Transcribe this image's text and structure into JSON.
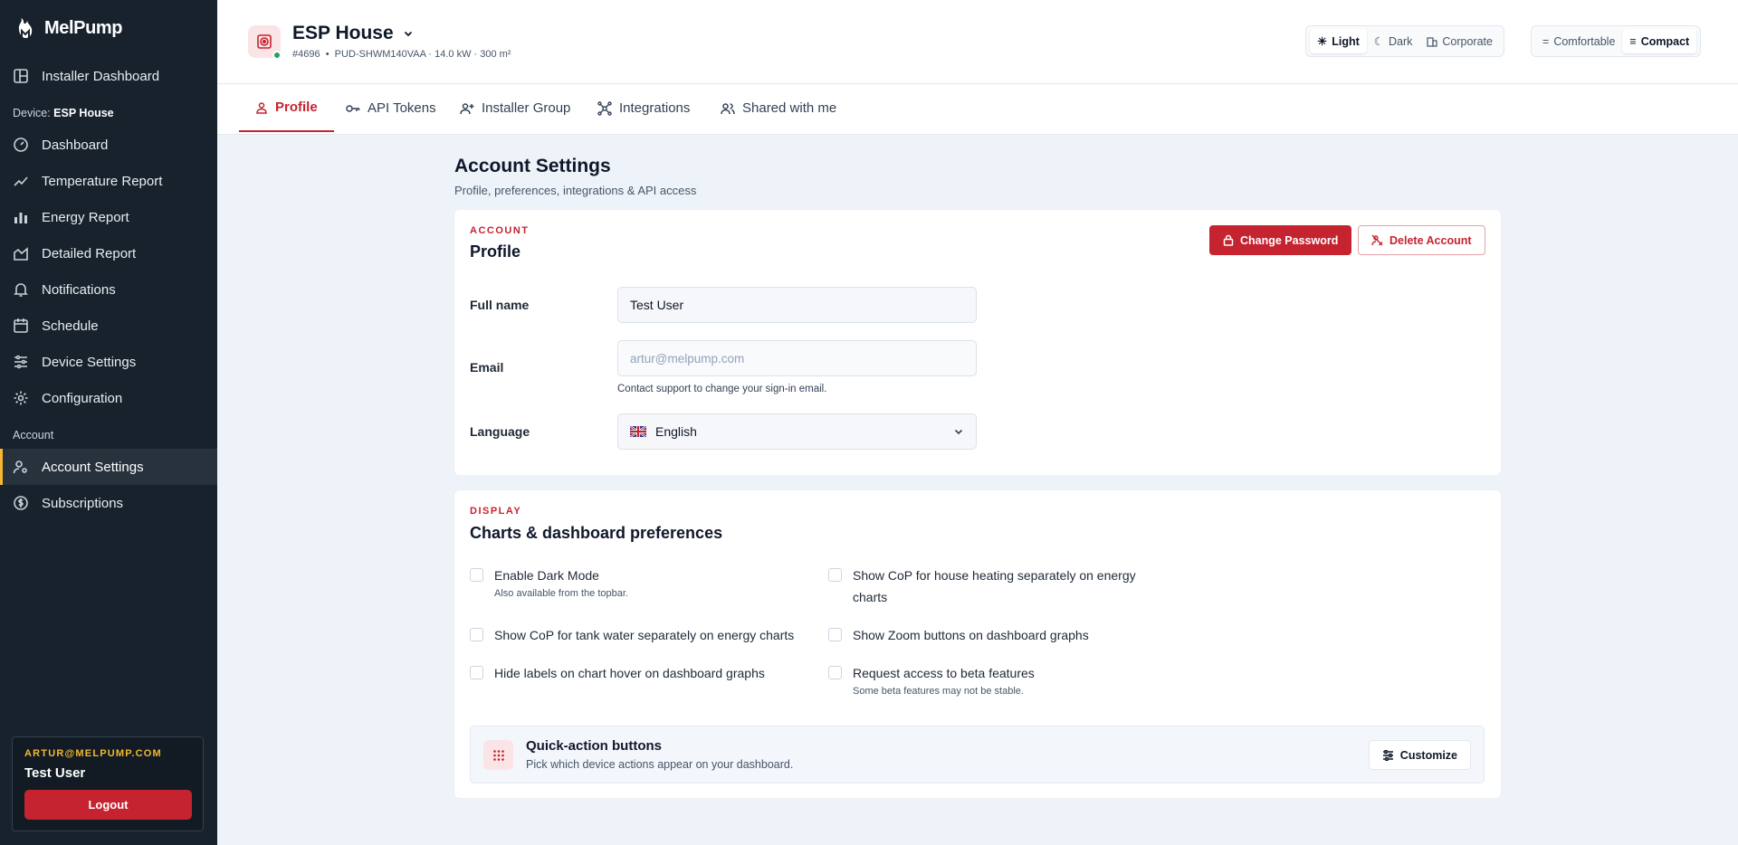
{
  "app": {
    "name": "MelPump"
  },
  "sidebar": {
    "installer_dashboard": "Installer Dashboard",
    "device_prefix": "Device:",
    "device_name": "ESP House",
    "items": [
      {
        "label": "Dashboard",
        "icon": "gauge-icon"
      },
      {
        "label": "Temperature Report",
        "icon": "line-chart-icon"
      },
      {
        "label": "Energy Report",
        "icon": "bar-chart-icon"
      },
      {
        "label": "Detailed Report",
        "icon": "area-chart-icon"
      },
      {
        "label": "Notifications",
        "icon": "bell-icon"
      },
      {
        "label": "Schedule",
        "icon": "calendar-icon"
      },
      {
        "label": "Device Settings",
        "icon": "sliders-icon"
      },
      {
        "label": "Configuration",
        "icon": "gear-icon"
      }
    ],
    "account_section": "Account",
    "account_items": [
      {
        "label": "Account Settings",
        "icon": "user-cog-icon",
        "active": true
      },
      {
        "label": "Subscriptions",
        "icon": "dollar-circle-icon"
      }
    ],
    "user": {
      "email": "ARTUR@MELPUMP.COM",
      "name": "Test User",
      "logout_label": "Logout"
    }
  },
  "topbar": {
    "device_name": "ESP House",
    "device_id": "#4696",
    "device_specs": "PUD-SHWM140VAA · 14.0 kW · 300 m²",
    "status_color": "#22a55a",
    "themes": [
      "Light",
      "Dark",
      "Corporate"
    ],
    "selected_theme": "Light",
    "density": [
      "Comfortable",
      "Compact"
    ],
    "selected_density": "Compact"
  },
  "tabs": [
    {
      "label": "Profile",
      "icon": "user-icon",
      "active": true
    },
    {
      "label": "API Tokens",
      "icon": "key-icon"
    },
    {
      "label": "Installer Group",
      "icon": "user-plus-icon"
    },
    {
      "label": "Integrations",
      "icon": "integration-icon"
    },
    {
      "label": "Shared with me",
      "icon": "users-icon"
    }
  ],
  "page": {
    "title": "Account Settings",
    "subtitle": "Profile, preferences, integrations & API access"
  },
  "profile_card": {
    "eyebrow": "ACCOUNT",
    "title": "Profile",
    "change_password": "Change Password",
    "delete_account": "Delete Account",
    "full_name_label": "Full name",
    "full_name_value": "Test User",
    "email_label": "Email",
    "email_placeholder": "artur@melpump.com",
    "email_help": "Contact support to change your sign-in email.",
    "language_label": "Language",
    "language_value": "English"
  },
  "display_card": {
    "eyebrow": "DISPLAY",
    "title": "Charts & dashboard preferences",
    "options": [
      {
        "label": "Enable Dark Mode",
        "sub": "Also available from the topbar.",
        "checked": false
      },
      {
        "label": "Show CoP for house heating separately on energy charts",
        "sub": "",
        "checked": false
      },
      {
        "label": "Show CoP for tank water separately on energy charts",
        "sub": "",
        "checked": false
      },
      {
        "label": "Show Zoom buttons on dashboard graphs",
        "sub": "",
        "checked": false
      },
      {
        "label": "Hide labels on chart hover on dashboard graphs",
        "sub": "",
        "checked": false
      },
      {
        "label": "Request access to beta features",
        "sub": "Some beta features may not be stable.",
        "checked": false
      }
    ],
    "quick_action": {
      "title": "Quick-action buttons",
      "subtitle": "Pick which device actions appear on your dashboard.",
      "button": "Customize"
    }
  },
  "colors": {
    "accent": "#c5232f",
    "sidebar_bg": "#17222c",
    "sidebar_active_marker": "#f5b82e"
  }
}
